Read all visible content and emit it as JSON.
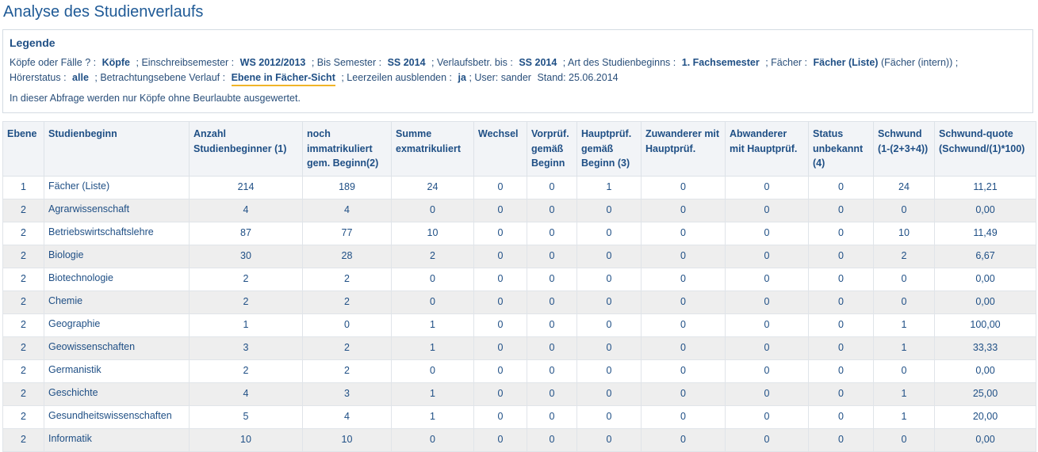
{
  "page_title": "Analyse des Studienverlaufs",
  "legend": {
    "heading": "Legende",
    "line1": [
      {
        "label": "Köpfe oder Fälle ? :",
        "value": "Köpfe"
      },
      {
        "label": "; Einschreibsemester :",
        "value": "WS 2012/2013"
      },
      {
        "label": "; Bis Semester :",
        "value": "SS 2014"
      },
      {
        "label": "; Verlaufsbetr. bis :",
        "value": "SS 2014"
      },
      {
        "label": "; Art des Studienbeginns :",
        "value": "1. Fachsemester"
      },
      {
        "label": "; Fächer :",
        "value": "Fächer (Liste)"
      }
    ],
    "line1_tail": "(Fächer (intern)) ;",
    "line2": {
      "hoerer_label": "Hörerstatus :",
      "hoerer_value": "alle",
      "ebene_label": "; Betrachtungsebene Verlauf :",
      "ebene_value": "Ebene in Fächer-Sicht",
      "leer_label": "; Leerzeilen ausblenden :",
      "leer_value": "ja",
      "user_text": "; User: sander",
      "stand_text": "Stand: 25.06.2014"
    },
    "note": "In dieser Abfrage werden nur Köpfe ohne Beurlaubte ausgewertet."
  },
  "table": {
    "headers": [
      "Ebene",
      "Studienbeginn",
      "Anzahl Studienbeginner (1)",
      "noch immatrikuliert gem. Beginn(2)",
      "Summe exmatrikuliert",
      "Wechsel",
      "Vorprüf. gemäß Beginn",
      "Hauptprüf. gemäß Beginn (3)",
      "Zuwanderer mit Hauptprüf.",
      "Abwanderer mit Hauptprüf.",
      "Status unbekannt (4)",
      "Schwund (1-(2+3+4))",
      "Schwund-quote (Schwund/(1)*100)"
    ],
    "rows": [
      [
        "1",
        "Fächer (Liste)",
        "214",
        "189",
        "24",
        "0",
        "0",
        "1",
        "0",
        "0",
        "0",
        "24",
        "11,21"
      ],
      [
        "2",
        "Agrarwissenschaft",
        "4",
        "4",
        "0",
        "0",
        "0",
        "0",
        "0",
        "0",
        "0",
        "0",
        "0,00"
      ],
      [
        "2",
        "Betriebswirtschaftslehre",
        "87",
        "77",
        "10",
        "0",
        "0",
        "0",
        "0",
        "0",
        "0",
        "10",
        "11,49"
      ],
      [
        "2",
        "Biologie",
        "30",
        "28",
        "2",
        "0",
        "0",
        "0",
        "0",
        "0",
        "0",
        "2",
        "6,67"
      ],
      [
        "2",
        "Biotechnologie",
        "2",
        "2",
        "0",
        "0",
        "0",
        "0",
        "0",
        "0",
        "0",
        "0",
        "0,00"
      ],
      [
        "2",
        "Chemie",
        "2",
        "2",
        "0",
        "0",
        "0",
        "0",
        "0",
        "0",
        "0",
        "0",
        "0,00"
      ],
      [
        "2",
        "Geographie",
        "1",
        "0",
        "1",
        "0",
        "0",
        "0",
        "0",
        "0",
        "0",
        "1",
        "100,00"
      ],
      [
        "2",
        "Geowissenschaften",
        "3",
        "2",
        "1",
        "0",
        "0",
        "0",
        "0",
        "0",
        "0",
        "1",
        "33,33"
      ],
      [
        "2",
        "Germanistik",
        "2",
        "2",
        "0",
        "0",
        "0",
        "0",
        "0",
        "0",
        "0",
        "0",
        "0,00"
      ],
      [
        "2",
        "Geschichte",
        "4",
        "3",
        "1",
        "0",
        "0",
        "0",
        "0",
        "0",
        "0",
        "1",
        "25,00"
      ],
      [
        "2",
        "Gesundheitswissenschaften",
        "5",
        "4",
        "1",
        "0",
        "0",
        "0",
        "0",
        "0",
        "0",
        "1",
        "20,00"
      ],
      [
        "2",
        "Informatik",
        "10",
        "10",
        "0",
        "0",
        "0",
        "0",
        "0",
        "0",
        "0",
        "0",
        "0,00"
      ]
    ]
  }
}
